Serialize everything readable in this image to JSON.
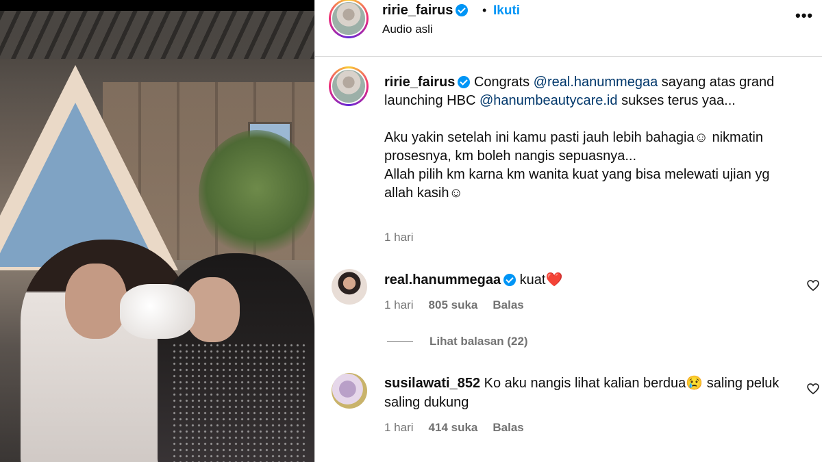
{
  "post": {
    "author": "ririe_fairus",
    "follow_label": "Ikuti",
    "separator": "•",
    "audio_label": "Audio asli",
    "more_icon": "more-horizontal-icon"
  },
  "caption": {
    "username": "ririe_fairus",
    "text_1": "Congrats ",
    "mention_1": "@real.hanummegaa",
    "text_2": " sayang atas grand launching HBC ",
    "mention_2": "@hanumbeautycare.id",
    "text_3": " sukses terus yaa...",
    "para_2": "Aku yakin setelah ini kamu pasti jauh lebih bahagia☺ nikmatin prosesnya, km boleh nangis sepuasnya...",
    "para_3": "Allah pilih km karna km wanita kuat yang bisa melewati ujian yg allah kasih☺",
    "time": "1 hari"
  },
  "comments": [
    {
      "username": "real.hanummegaa",
      "verified": true,
      "text": "kuat❤️",
      "time": "1 hari",
      "likes": "805 suka",
      "reply_label": "Balas",
      "view_replies": "Lihat balasan (22)"
    },
    {
      "username": "susilawati_852",
      "verified": false,
      "text": "Ko aku nangis lihat kalian berdua😢 saling peluk saling dukung",
      "time": "1 hari",
      "likes": "414 suka",
      "reply_label": "Balas"
    }
  ],
  "colors": {
    "link_blue": "#0095f6",
    "mention": "#00376b",
    "muted": "#737373",
    "divider": "#dbdbdb"
  }
}
